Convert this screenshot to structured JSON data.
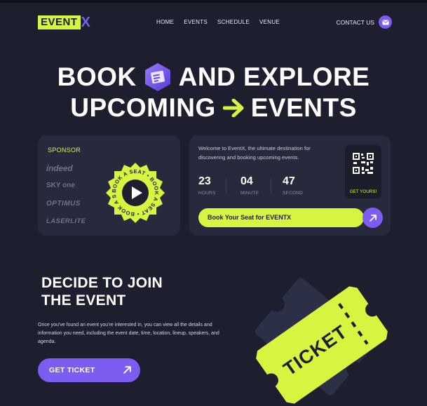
{
  "nav": {
    "logo_event": "EVENT",
    "logo_x": "X",
    "links": [
      "HOME",
      "EVENTS",
      "SCHEDULE",
      "VENUE"
    ],
    "contact": "CONTACT US",
    "contact_icon": "mail-icon"
  },
  "hero": {
    "word_book": "BOOK",
    "word_and_explore": "AND EXPLORE",
    "word_upcoming": "UPCOMING",
    "word_events": "EVENTS",
    "ticket_icon": "ticket-icon",
    "arrow_icon": "arrow-right-icon"
  },
  "sponsor": {
    "title": "SPONSOR",
    "brands": [
      "indeed",
      "SKY one",
      "OPTIMUS",
      "LASERLITE"
    ],
    "badge_text": "BOOK A SEAT • BOOK A SEAT • BOOK A SEAT •",
    "badge_icon": "play-icon"
  },
  "countdown": {
    "welcome": "Welcome to EventX, the ultimate destination for discovering and booking upcoming events.",
    "hours": "23",
    "hours_label": "HOURS",
    "minutes": "04",
    "minutes_label": "MINUTE",
    "seconds": "47",
    "seconds_label": "SECOND",
    "qr_label": "GET YOURS!",
    "book_label": "Book Your Seat for EVENTX",
    "book_icon": "arrow-up-right-icon"
  },
  "decide": {
    "title_line1": "DECIDE TO JOIN",
    "title_line2": "THE EVENT",
    "body": "Once you've found an event you're interested in, you can view all the details and information you need, including the event date, time, location, lineup, speakers, and agenda.",
    "button_label": "GET TICKET",
    "ticket_text": "TICKET"
  },
  "colors": {
    "background": "#1e1f2e",
    "card": "#272a3c",
    "accent_lime": "#d7f540",
    "accent_purple": "#7d5cf2"
  }
}
